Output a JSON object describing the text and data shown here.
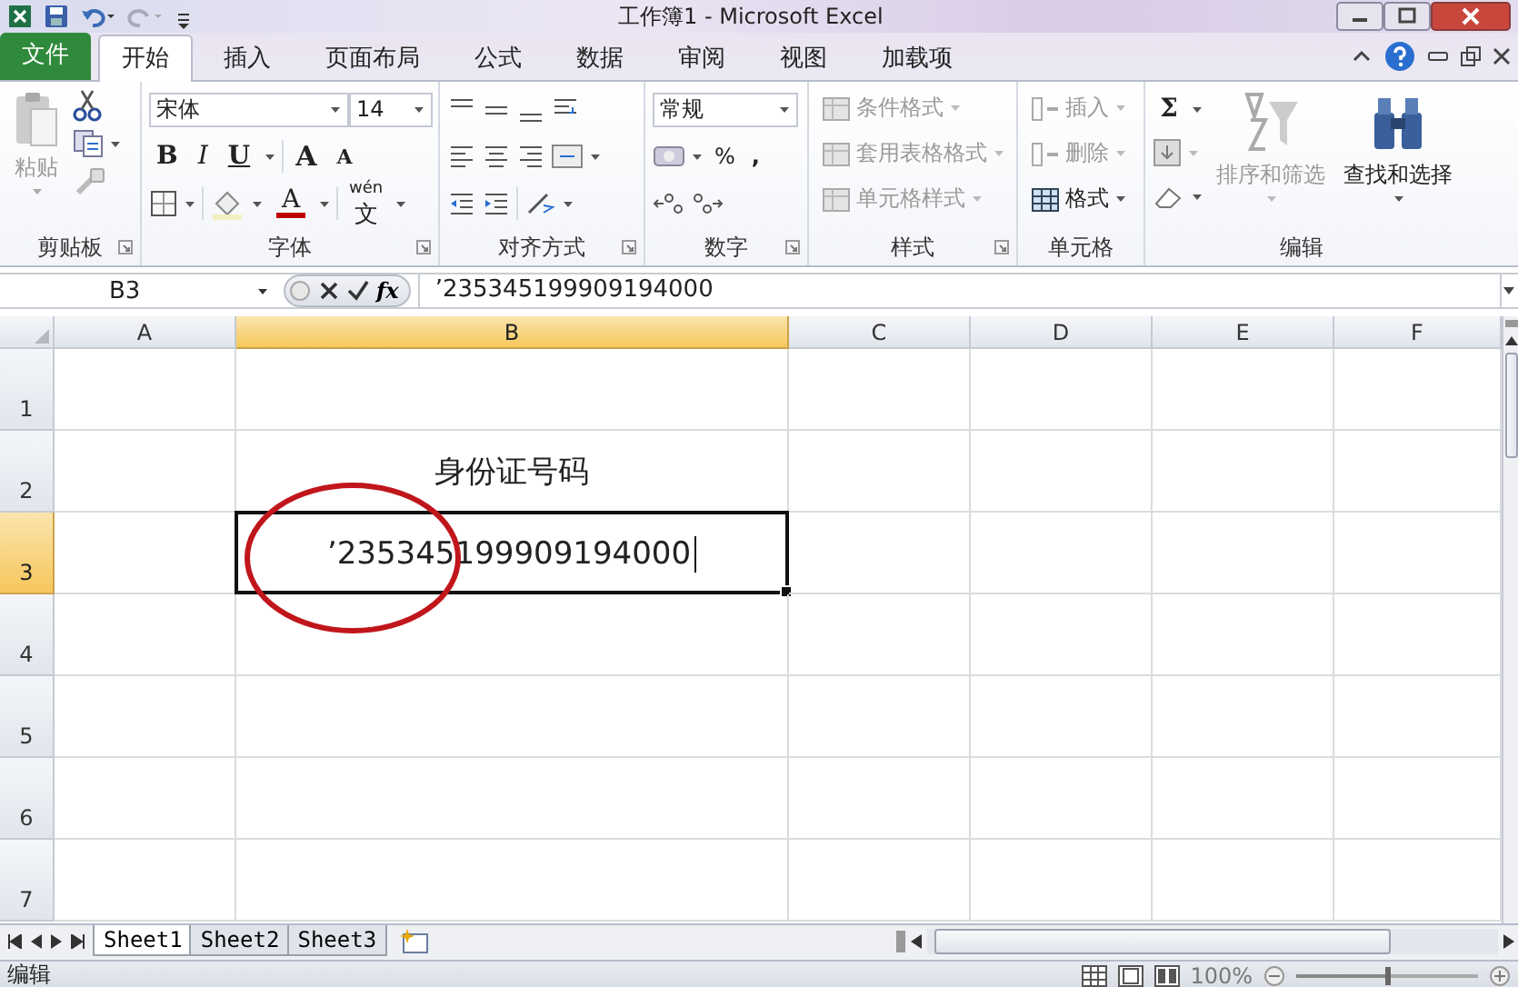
{
  "window": {
    "title": "工作簿1 - Microsoft Excel"
  },
  "tabs": [
    {
      "label": "文件",
      "kind": "file",
      "selected": false
    },
    {
      "label": "开始",
      "kind": "tab",
      "selected": true
    },
    {
      "label": "插入",
      "kind": "tab",
      "selected": false
    },
    {
      "label": "页面布局",
      "kind": "tab",
      "selected": false
    },
    {
      "label": "公式",
      "kind": "tab",
      "selected": false
    },
    {
      "label": "数据",
      "kind": "tab",
      "selected": false
    },
    {
      "label": "审阅",
      "kind": "tab",
      "selected": false
    },
    {
      "label": "视图",
      "kind": "tab",
      "selected": false
    },
    {
      "label": "加载项",
      "kind": "tab",
      "selected": false
    }
  ],
  "ribbon": {
    "clipboard": {
      "label": "剪贴板",
      "paste": {
        "label": "粘贴",
        "disabled": true
      }
    },
    "font": {
      "label": "字体",
      "font_name": "宋体",
      "font_size": "14",
      "bold": "B",
      "italic": "I",
      "underline": "U",
      "grow": "A",
      "shrink": "A",
      "font_color": "A",
      "phonetic": "文",
      "phonetic_pinyin": "wén"
    },
    "alignment": {
      "label": "对齐方式"
    },
    "number": {
      "label": "数字",
      "format": "常规",
      "percent": "%",
      "comma": ","
    },
    "styles": {
      "label": "样式",
      "items": [
        {
          "label": "条件格式",
          "disabled": true
        },
        {
          "label": "套用表格格式",
          "disabled": true
        },
        {
          "label": "单元格样式",
          "disabled": true
        }
      ]
    },
    "cells": {
      "label": "单元格",
      "items": [
        {
          "label": "插入",
          "disabled": true
        },
        {
          "label": "删除",
          "disabled": true
        },
        {
          "label": "格式",
          "disabled": false
        }
      ]
    },
    "editing": {
      "label": "编辑",
      "sum": "Σ",
      "sort_filter": {
        "label": "排序和筛选",
        "disabled": true
      },
      "find_select": {
        "label": "查找和选择",
        "disabled": false
      }
    }
  },
  "formula_bar": {
    "name_box": "B3",
    "fx": "fx",
    "formula": "’235345199909194000"
  },
  "sheet": {
    "columns": [
      {
        "label": "A",
        "selected": false
      },
      {
        "label": "B",
        "selected": true
      },
      {
        "label": "C",
        "selected": false
      },
      {
        "label": "D",
        "selected": false
      },
      {
        "label": "E",
        "selected": false
      },
      {
        "label": "F",
        "selected": false
      }
    ],
    "rows": [
      {
        "label": "1",
        "selected": false,
        "cells": {}
      },
      {
        "label": "2",
        "selected": false,
        "cells": {
          "B": {
            "text": "身份证号码",
            "editing": false
          }
        }
      },
      {
        "label": "3",
        "selected": true,
        "cells": {
          "B": {
            "text": "’235345199909194000",
            "editing": true
          }
        }
      },
      {
        "label": "4",
        "selected": false,
        "cells": {}
      },
      {
        "label": "5",
        "selected": false,
        "cells": {}
      },
      {
        "label": "6",
        "selected": false,
        "cells": {}
      },
      {
        "label": "7",
        "selected": false,
        "cells": {}
      }
    ]
  },
  "sheet_tabs": [
    {
      "label": "Sheet1",
      "selected": true
    },
    {
      "label": "Sheet2",
      "selected": false
    },
    {
      "label": "Sheet3",
      "selected": false
    }
  ],
  "status_bar": {
    "mode": "编辑",
    "zoom": "100%",
    "zoom_slider": {
      "level": 0.5
    }
  }
}
